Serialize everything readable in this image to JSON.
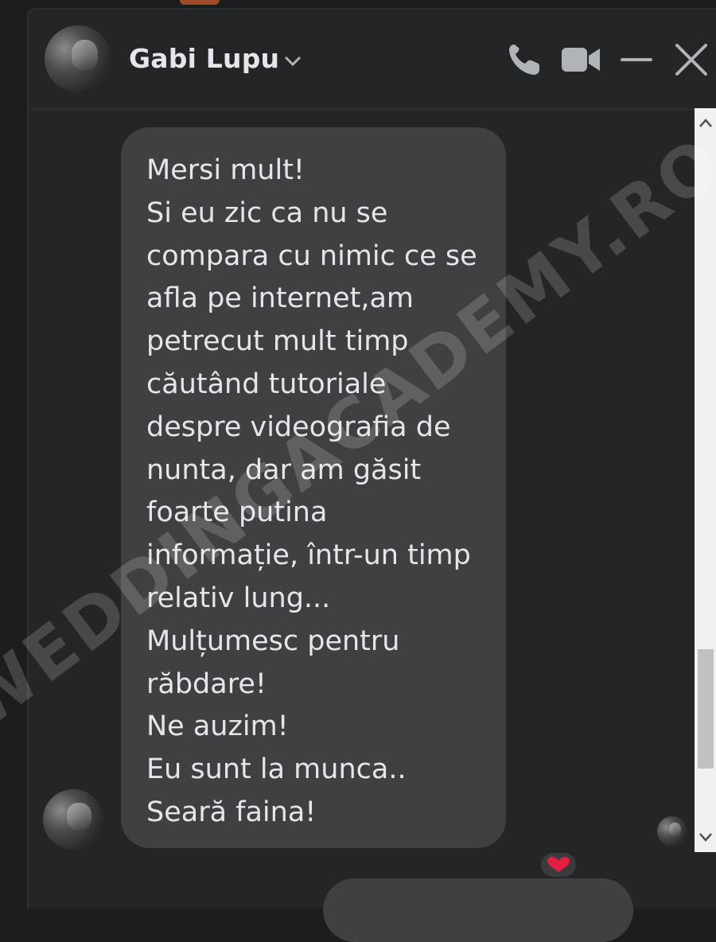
{
  "header": {
    "contact_name": "Gabi Lupu",
    "icons": [
      "chevron-down-icon",
      "phone-icon",
      "video-camera-icon",
      "minimize-icon",
      "close-icon"
    ]
  },
  "message": {
    "lines": [
      "Mersi mult!",
      "Si eu zic ca nu se",
      "compara cu nimic ce se",
      "afla pe internet,am",
      "petrecut mult timp",
      "căutând tutoriale",
      "despre videografia de",
      "nunta, dar am găsit",
      "foarte putina",
      "informație, într-un timp",
      "relativ lung...",
      "Mulțumesc pentru",
      "răbdare!",
      "Ne auzim!",
      "Eu sunt la munca..",
      "Seară faina!"
    ],
    "reaction": "heart-icon"
  },
  "watermark": "WEDDINGACADEMY.RO",
  "colors": {
    "background": "#242526",
    "bubble": "#3e4042",
    "text": "#e4e6eb",
    "icons": "#b0b3b8",
    "reaction": "#e41e3f"
  }
}
